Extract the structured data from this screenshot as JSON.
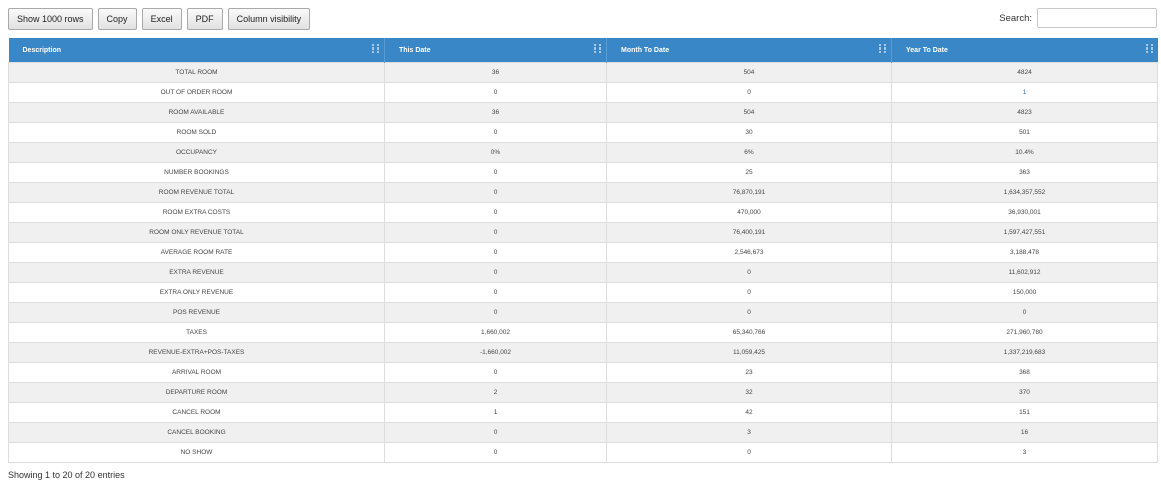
{
  "toolbar": {
    "buttons": [
      "Show 1000 rows",
      "Copy",
      "Excel",
      "PDF",
      "Column visibility"
    ]
  },
  "search": {
    "label": "Search:",
    "value": "",
    "placeholder": ""
  },
  "table": {
    "headers": [
      "Description",
      "This Date",
      "Month To Date",
      "Year To Date"
    ],
    "rows": [
      [
        "TOTAL ROOM",
        "36",
        "504",
        "4824"
      ],
      [
        "OUT OF ORDER ROOM",
        "0",
        "0",
        "1"
      ],
      [
        "ROOM AVAILABLE",
        "36",
        "504",
        "4823"
      ],
      [
        "ROOM SOLD",
        "0",
        "30",
        "501"
      ],
      [
        "OCCUPANCY",
        "0%",
        "6%",
        "10.4%"
      ],
      [
        "NUMBER BOOKINGS",
        "0",
        "25",
        "363"
      ],
      [
        "ROOM REVENUE TOTAL",
        "0",
        "76,870,191",
        "1,634,357,552"
      ],
      [
        "ROOM EXTRA COSTS",
        "0",
        "470,000",
        "36,930,001"
      ],
      [
        "ROOM ONLY REVENUE TOTAL",
        "0",
        "76,400,191",
        "1,597,427,551"
      ],
      [
        "AVERAGE ROOM RATE",
        "0",
        "2,546,673",
        "3,188,478"
      ],
      [
        "EXTRA REVENUE",
        "0",
        "0",
        "11,602,912"
      ],
      [
        "EXTRA ONLY REVENUE",
        "0",
        "0",
        "150,000"
      ],
      [
        "POS REVENUE",
        "0",
        "0",
        "0"
      ],
      [
        "TAXES",
        "1,660,002",
        "65,340,766",
        "271,960,780"
      ],
      [
        "REVENUE-EXTRA+POS-TAXES",
        "-1,660,002",
        "11,059,425",
        "1,337,219,683"
      ],
      [
        "ARRIVAL ROOM",
        "0",
        "23",
        "368"
      ],
      [
        "DEPARTURE ROOM",
        "2",
        "32",
        "370"
      ],
      [
        "CANCEL ROOM",
        "1",
        "42",
        "151"
      ],
      [
        "CANCEL BOOKING",
        "0",
        "3",
        "16"
      ],
      [
        "NO SHOW",
        "0",
        "0",
        "3"
      ]
    ]
  },
  "info": "Showing 1 to 20 of 20 entries",
  "colors": {
    "header_bg": "#3a87c7",
    "link": "#3a7bbf"
  },
  "icons": {
    "sort": "sort-icon"
  }
}
